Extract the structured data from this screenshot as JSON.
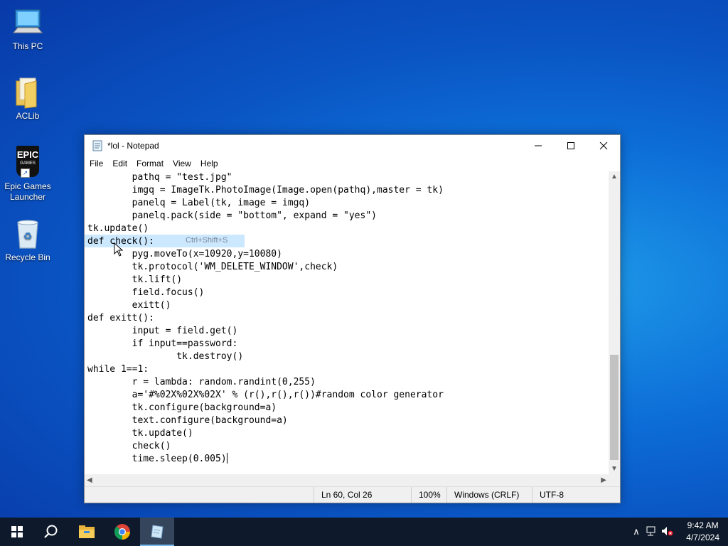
{
  "desktop": {
    "icons": [
      {
        "label": "This PC",
        "icon": "computer-icon"
      },
      {
        "label": "ACLib",
        "icon": "folder-icon"
      },
      {
        "label": "Epic Games Launcher",
        "icon": "epic-games-icon",
        "badge": "EPIC",
        "badge_sub": "GAMES"
      },
      {
        "label": "Recycle Bin",
        "icon": "recycle-bin-icon"
      }
    ]
  },
  "window": {
    "title": "*lol - Notepad",
    "menu": [
      "File",
      "Edit",
      "Format",
      "View",
      "Help"
    ],
    "tooltip": "Ctrl+Shift+S",
    "code_before": "        pathq = \"test.jpg\"\n        imgq = ImageTk.PhotoImage(Image.open(pathq),master = tk)\n        panelq = Label(tk, image = imgq)\n        panelq.pack(side = \"bottom\", expand = \"yes\")\ntk.update()\n",
    "code_selected": "def check():",
    "code_after": "\n        pyg.moveTo(x=10920,y=10080)\n        tk.protocol('WM_DELETE_WINDOW',check)\n        tk.lift()\n        field.focus()\n        exitt()\ndef exitt():\n        input = field.get()\n        if input==password:\n                tk.destroy()\nwhile 1==1:\n        r = lambda: random.randint(0,255)\n        a='#%02X%02X%02X' % (r(),r(),r())#random color generator\n        tk.configure(background=a)\n        text.configure(background=a)\n        tk.update()\n        check()\n        time.sleep(0.005)",
    "status": {
      "position": "Ln 60, Col 26",
      "zoom": "100%",
      "line_ending": "Windows (CRLF)",
      "encoding": "UTF-8"
    }
  },
  "taskbar": {
    "time": "9:42 AM",
    "date": "4/7/2024",
    "accent": "#76b9ed"
  }
}
